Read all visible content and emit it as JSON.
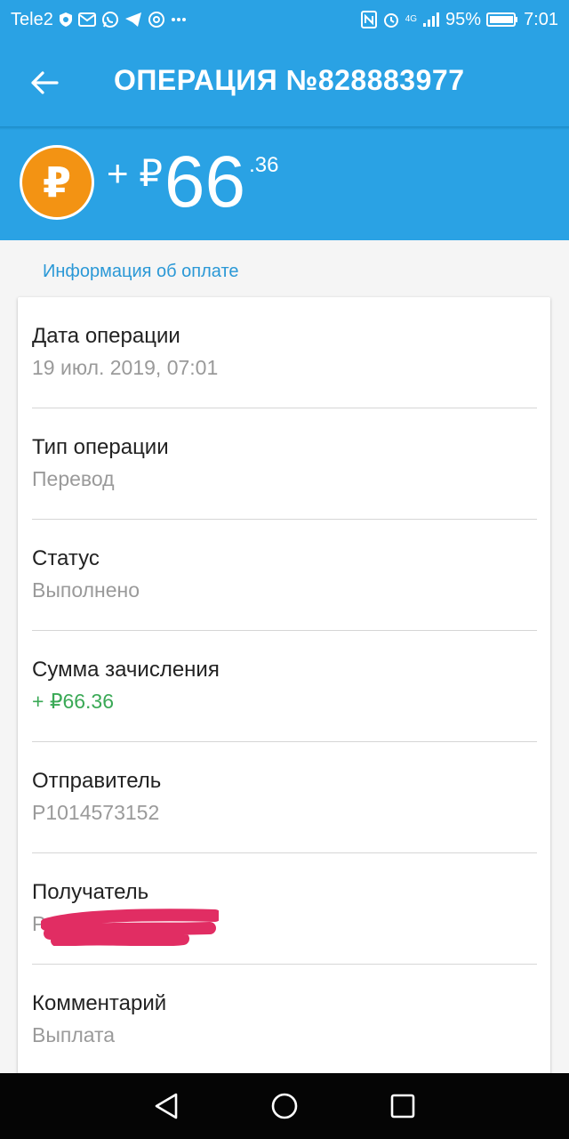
{
  "status_bar": {
    "carrier": "Tele2",
    "notification_icons": [
      "shield-icon",
      "mail-icon",
      "whatsapp-icon",
      "telegram-icon",
      "at-icon",
      "more-icon"
    ],
    "right_icons": [
      "nfc-icon",
      "alarm-icon",
      "signal-icon",
      "battery-icon"
    ],
    "network": "4G",
    "battery": "95%",
    "time": "7:01"
  },
  "header": {
    "title": "ОПЕРАЦИЯ №828883977",
    "back_icon": "arrow-left-icon"
  },
  "amount": {
    "coin_symbol": "₽",
    "prefix": "+ ₽",
    "main": "66",
    "cents": ".36"
  },
  "section_label": "Информация об оплате",
  "rows": [
    {
      "label": "Дата операции",
      "value": "19 июл. 2019, 07:01"
    },
    {
      "label": "Тип операции",
      "value": "Перевод"
    },
    {
      "label": "Статус",
      "value": "Выполнено"
    },
    {
      "label": "Сумма зачисления",
      "value": "+ ₽66.36"
    },
    {
      "label": "Отправитель",
      "value": "P1014573152"
    },
    {
      "label": "Получатель",
      "value": "P"
    },
    {
      "label": "Комментарий",
      "value": "Выплата"
    }
  ],
  "colors": {
    "primary": "#2aa2e4",
    "coin": "#f39313",
    "positive": "#3aa956",
    "redaction": "#e12d63"
  },
  "nav": [
    "back-triangle-icon",
    "home-circle-icon",
    "recent-square-icon"
  ]
}
